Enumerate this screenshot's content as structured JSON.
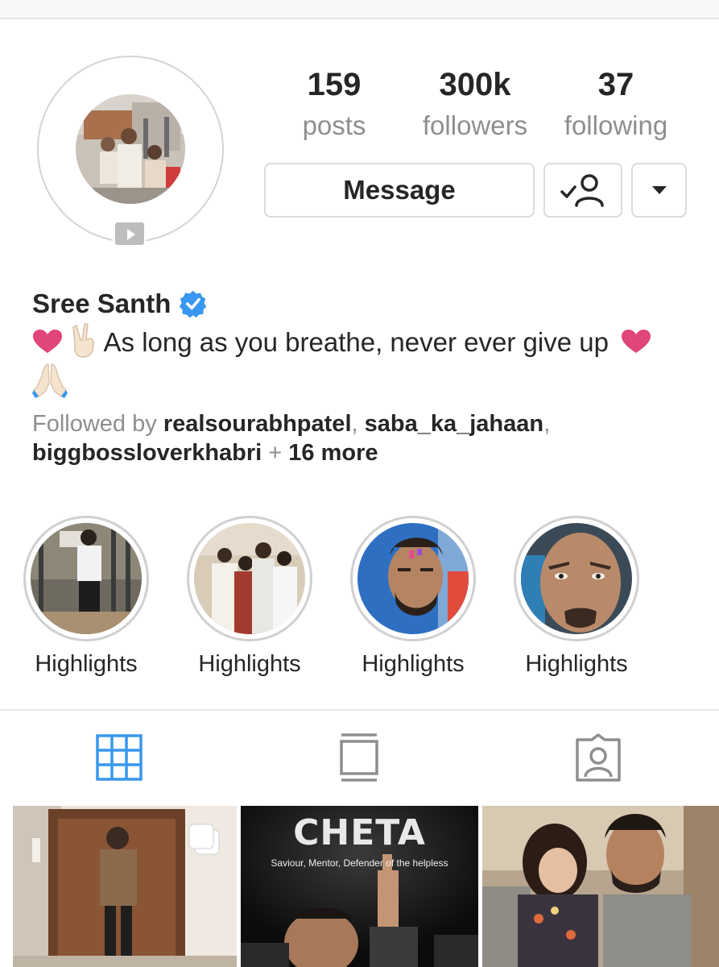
{
  "profile": {
    "name": "Sree Santh",
    "verified": true,
    "stats": {
      "posts": {
        "count": "159",
        "label": "posts"
      },
      "followers": {
        "count": "300k",
        "label": "followers"
      },
      "following": {
        "count": "37",
        "label": "following"
      }
    },
    "bio": "As long as you breathe, never ever give up",
    "followed_by": {
      "prefix": "Followed by",
      "users": [
        "realsourabhpatel",
        "saba_ka_jahaan",
        "biggbossloverkhabri"
      ],
      "more": "16 more"
    }
  },
  "actions": {
    "message_label": "Message"
  },
  "highlights": [
    {
      "label": "Highlights"
    },
    {
      "label": "Highlights"
    },
    {
      "label": "Highlights"
    },
    {
      "label": "Highlights"
    }
  ],
  "tabs": [
    {
      "icon": "grid-icon",
      "active": true
    },
    {
      "icon": "feed-icon",
      "active": false
    },
    {
      "icon": "tagged-icon",
      "active": false
    }
  ],
  "posts": [
    {
      "type": "carousel"
    },
    {
      "title": "CHETA",
      "subtitle": "Saviour, Mentor, Defender of the helpless"
    },
    {
      "type": "photo"
    }
  ],
  "colors": {
    "active_tab": "#3897f0",
    "verified": "#3897f0",
    "muted_text": "#8e8e8e",
    "heart": "#e0457b"
  }
}
